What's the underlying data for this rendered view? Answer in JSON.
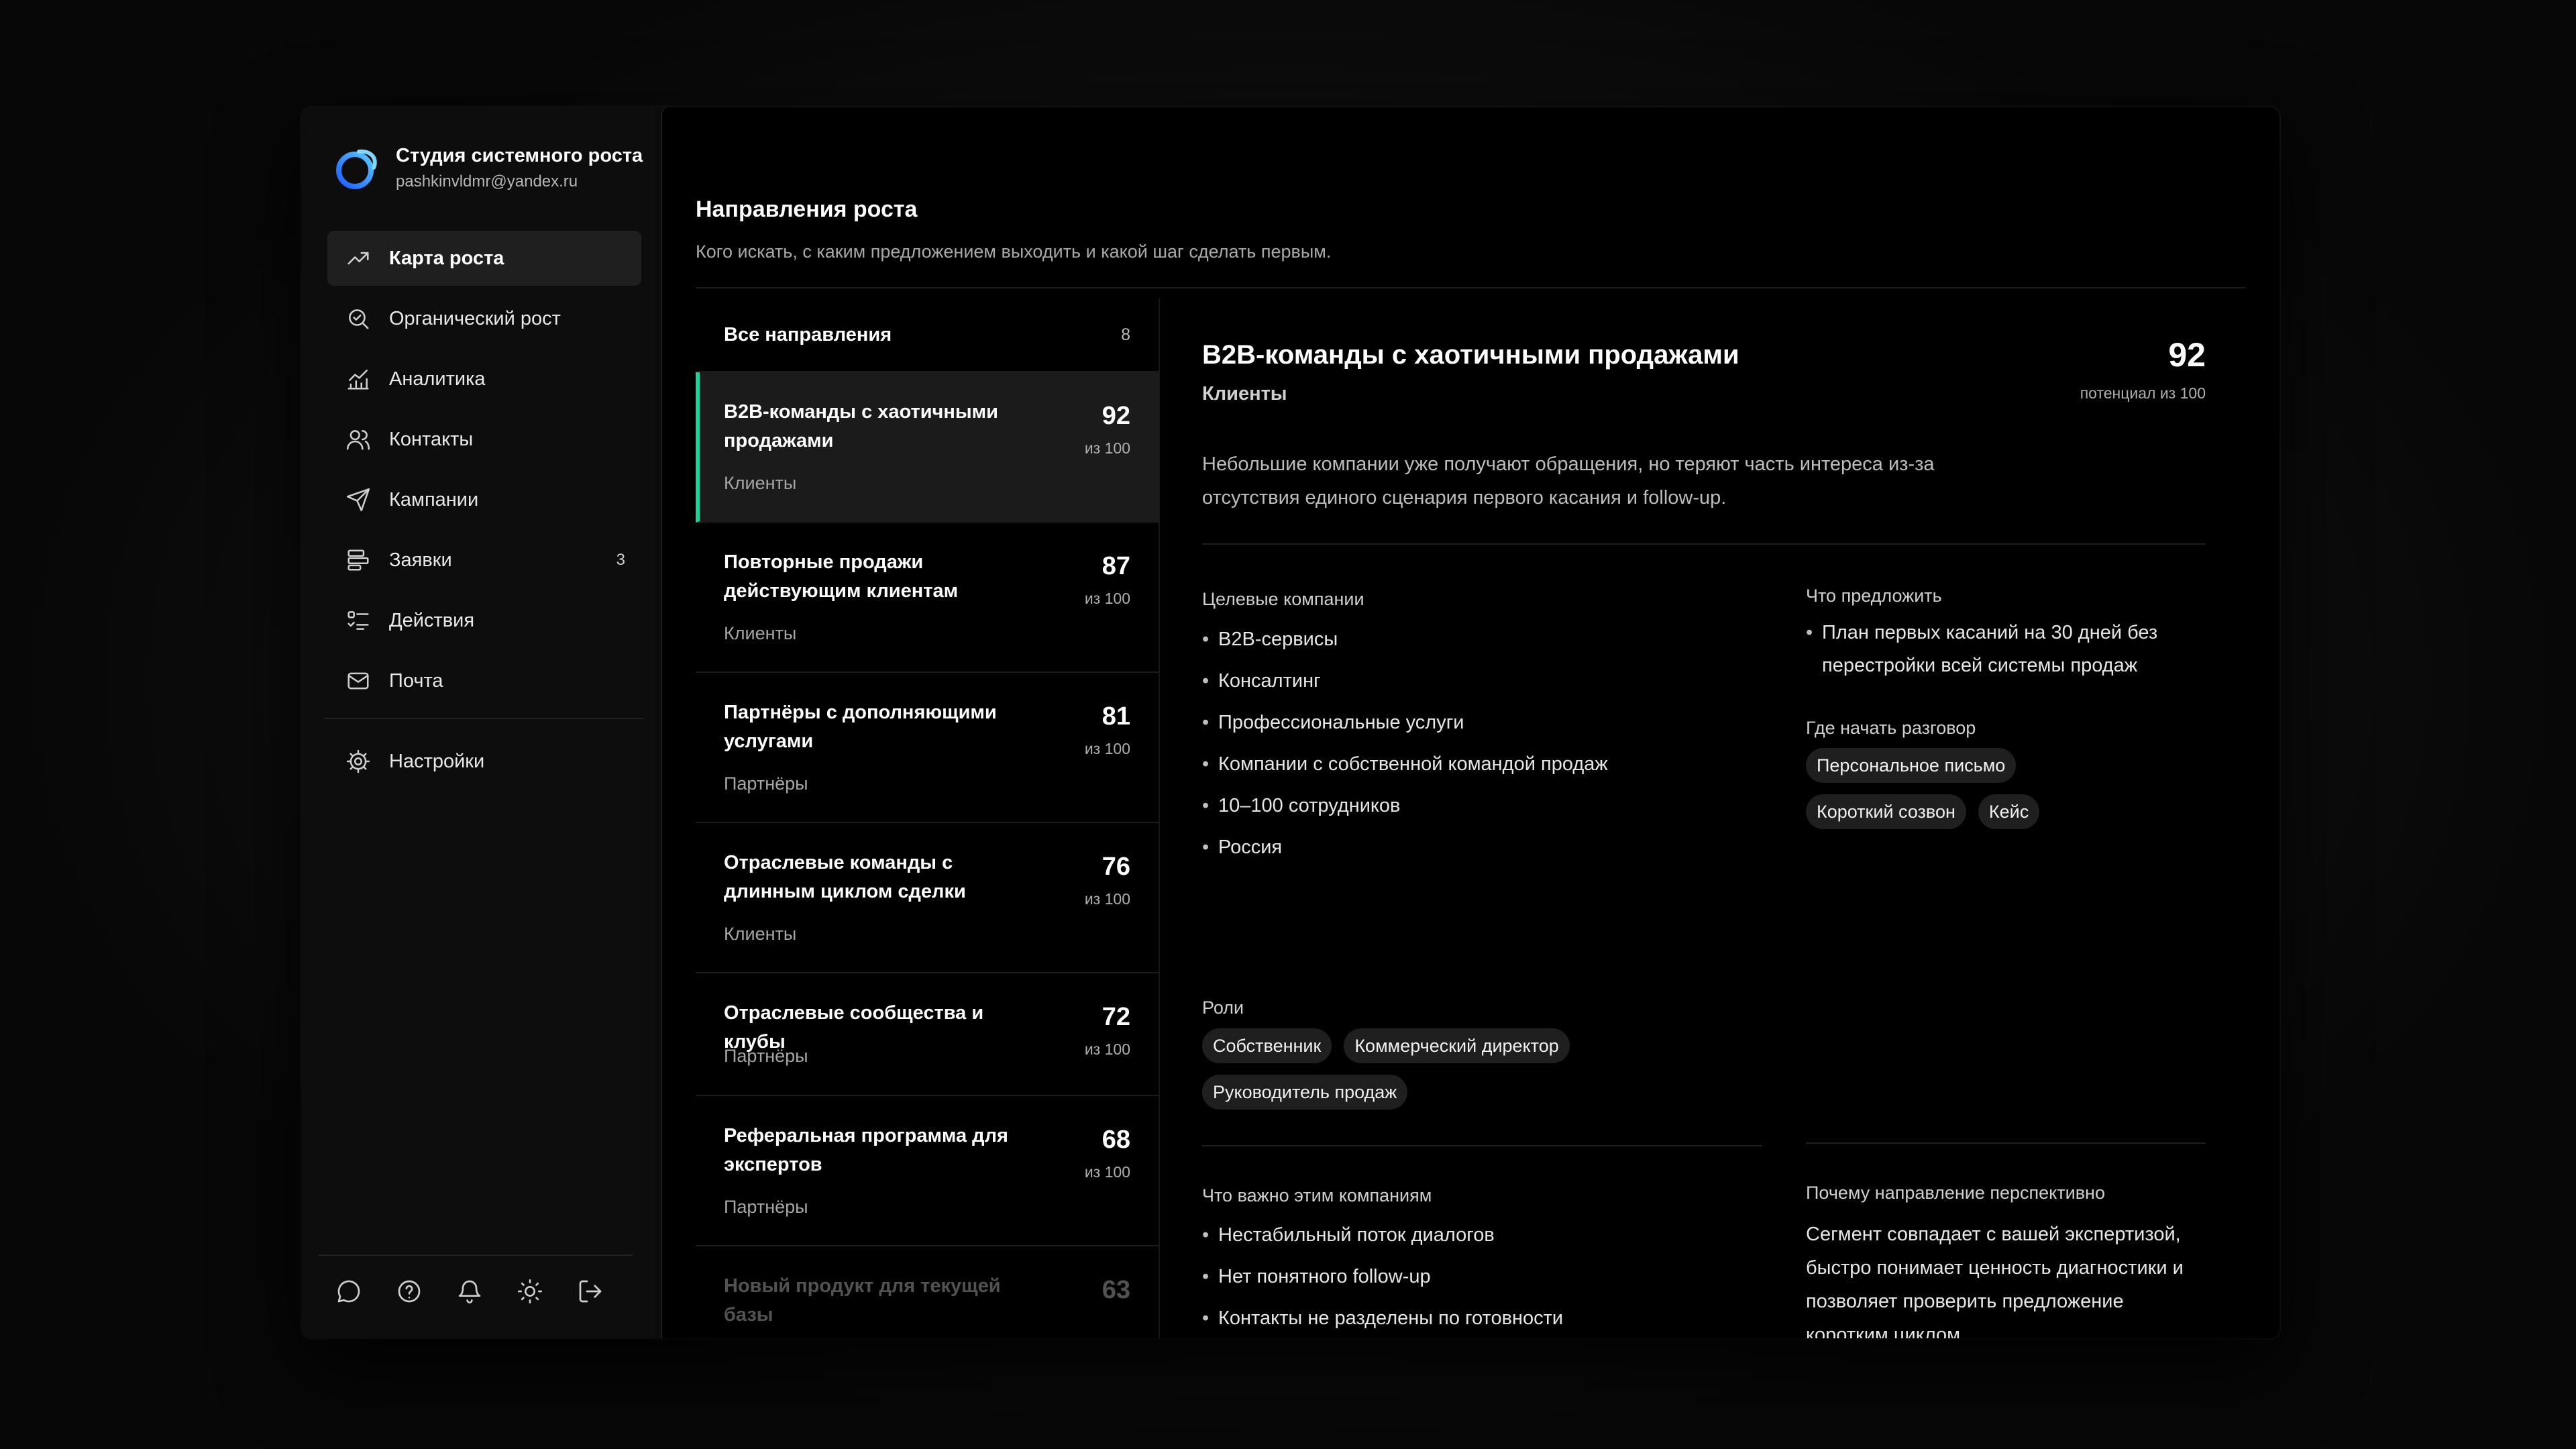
{
  "brand": {
    "name": "Студия системного роста",
    "email": "pashkinvldmr@yandex.ru"
  },
  "nav": [
    {
      "label": "Карта роста",
      "icon": "trend-up-icon",
      "active": true
    },
    {
      "label": "Органический рост",
      "icon": "search-check-icon"
    },
    {
      "label": "Аналитика",
      "icon": "analytics-chart-icon"
    },
    {
      "label": "Контакты",
      "icon": "contacts-icon"
    },
    {
      "label": "Кампании",
      "icon": "send-icon"
    },
    {
      "label": "Заявки",
      "icon": "requests-icon",
      "badge": "3"
    },
    {
      "label": "Действия",
      "icon": "checklist-icon"
    },
    {
      "label": "Почта",
      "icon": "mail-icon"
    }
  ],
  "settings": {
    "label": "Настройки",
    "icon": "gear-icon"
  },
  "footer_icons": [
    "chat-icon",
    "help-icon",
    "bell-icon",
    "sun-icon",
    "logout-icon"
  ],
  "page": {
    "title": "Направления роста",
    "subtitle": "Кого искать, с каким предложением выходить и какой шаг сделать первым."
  },
  "list": {
    "header_label": "Все направления",
    "header_count": "8",
    "of_label": "из 100",
    "items": [
      {
        "title": "B2B-команды с хаотичными продажами",
        "category": "Клиенты",
        "score": "92",
        "lines": 2,
        "active": true
      },
      {
        "title": "Повторные продажи действующим клиентам",
        "category": "Клиенты",
        "score": "87",
        "lines": 2
      },
      {
        "title": "Партнёры с дополняющими услугами",
        "category": "Партнёры",
        "score": "81",
        "lines": 2
      },
      {
        "title": "Отраслевые команды с длинным циклом сделки",
        "category": "Клиенты",
        "score": "76",
        "lines": 2
      },
      {
        "title": "Отраслевые сообщества и клубы",
        "category": "Партнёры",
        "score": "72",
        "lines": 1
      },
      {
        "title": "Реферальная программа для экспертов",
        "category": "Партнёры",
        "score": "68",
        "lines": 2
      },
      {
        "title": "Новый продукт для текущей базы",
        "category": "",
        "score": "63",
        "lines": 1,
        "faded": true
      }
    ]
  },
  "detail": {
    "title": "B2B-команды с хаотичными продажами",
    "category": "Клиенты",
    "score": "92",
    "score_caption": "потенциал из 100",
    "description": "Небольшие компании уже получают обращения, но теряют часть интереса из-за отсутствия единого сценария первого касания и follow-up.",
    "targets_label": "Целевые компании",
    "targets": [
      "B2B-сервисы",
      "Консалтинг",
      "Профессиональные услуги",
      "Компании с собственной командой продаж",
      "10–100 сотрудников",
      "Россия"
    ],
    "roles_label": "Роли",
    "roles": [
      "Собственник",
      "Коммерческий директор",
      "Руководитель продаж"
    ],
    "offer_label": "Что предложить",
    "offer": [
      "План первых касаний на 30 дней без перестройки всей системы продаж"
    ],
    "start_label": "Где начать разговор",
    "start_chips": [
      "Персональное письмо",
      "Короткий созвон",
      "Кейс"
    ],
    "important_label": "Что важно этим компаниям",
    "important": [
      "Нестабильный поток диалогов",
      "Нет понятного follow-up",
      "Контакты не разделены по готовности"
    ],
    "why_label": "Почему направление перспективно",
    "why": "Сегмент совпадает с вашей экспертизой, быстро понимает ценность диагностики и позволяет проверить предложение коротким циклом."
  }
}
